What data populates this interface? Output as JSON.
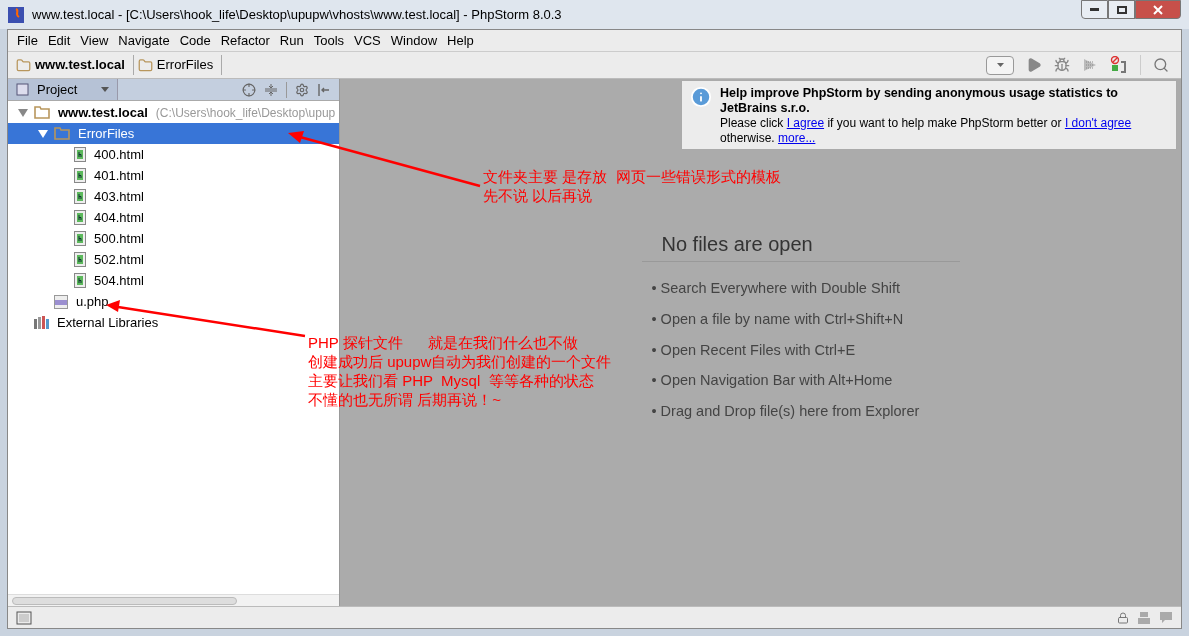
{
  "window": {
    "title": "www.test.local - [C:\\Users\\hook_life\\Desktop\\upupw\\vhosts\\www.test.local] - PhpStorm 8.0.3"
  },
  "menu": [
    "File",
    "Edit",
    "View",
    "Navigate",
    "Code",
    "Refactor",
    "Run",
    "Tools",
    "VCS",
    "Window",
    "Help"
  ],
  "breadcrumbs": [
    {
      "label": "www.test.local",
      "bold": true
    },
    {
      "label": "ErrorFiles",
      "bold": false
    }
  ],
  "project_panel": {
    "title": "Project",
    "tree": [
      {
        "label": "www.test.local",
        "path": "(C:\\Users\\hook_life\\Desktop\\upup",
        "kind": "folder",
        "expanded": true,
        "selected": false,
        "children": [
          {
            "label": "ErrorFiles",
            "kind": "folder",
            "expanded": true,
            "selected": true,
            "children": [
              {
                "label": "400.html",
                "kind": "html",
                "selected": false
              },
              {
                "label": "401.html",
                "kind": "html",
                "selected": false
              },
              {
                "label": "403.html",
                "kind": "html",
                "selected": false
              },
              {
                "label": "404.html",
                "kind": "html",
                "selected": false
              },
              {
                "label": "500.html",
                "kind": "html",
                "selected": false
              },
              {
                "label": "502.html",
                "kind": "html",
                "selected": false
              },
              {
                "label": "504.html",
                "kind": "html",
                "selected": false
              }
            ]
          },
          {
            "label": "u.php",
            "kind": "php",
            "selected": false
          }
        ]
      },
      {
        "label": "External Libraries",
        "kind": "library",
        "selected": false
      }
    ]
  },
  "notification": {
    "title": "Help improve PhpStorm by sending anonymous usage statistics to JetBrains s.r.o.",
    "text_before": "Please click",
    "agree_link": "I agree",
    "text_middle": "if you want to help make PhpStorm better or",
    "disagree_link": "I don't agree",
    "text_after": "otherwise.",
    "more_link": "more..."
  },
  "editor": {
    "heading": "No files are open",
    "hints": [
      "• Search Everywhere with Double Shift",
      "• Open a file by name with Ctrl+Shift+N",
      "• Open Recent Files with Ctrl+E",
      "• Open Navigation Bar with Alt+Home",
      "• Drag and Drop file(s) here from Explorer"
    ]
  },
  "annotations": [
    {
      "lines": [
        "文件夹主要 是存放  网页一些错误形式的模板",
        "先不说 以后再说"
      ]
    },
    {
      "lines": [
        "PHP 探针文件      就是在我们什么也不做",
        "创建成功后 upupw自动为我们创建的一个文件",
        "主要让我们看 PHP  Mysql  等等各种的状态",
        "不懂的也无所谓 后期再说！~"
      ]
    }
  ]
}
